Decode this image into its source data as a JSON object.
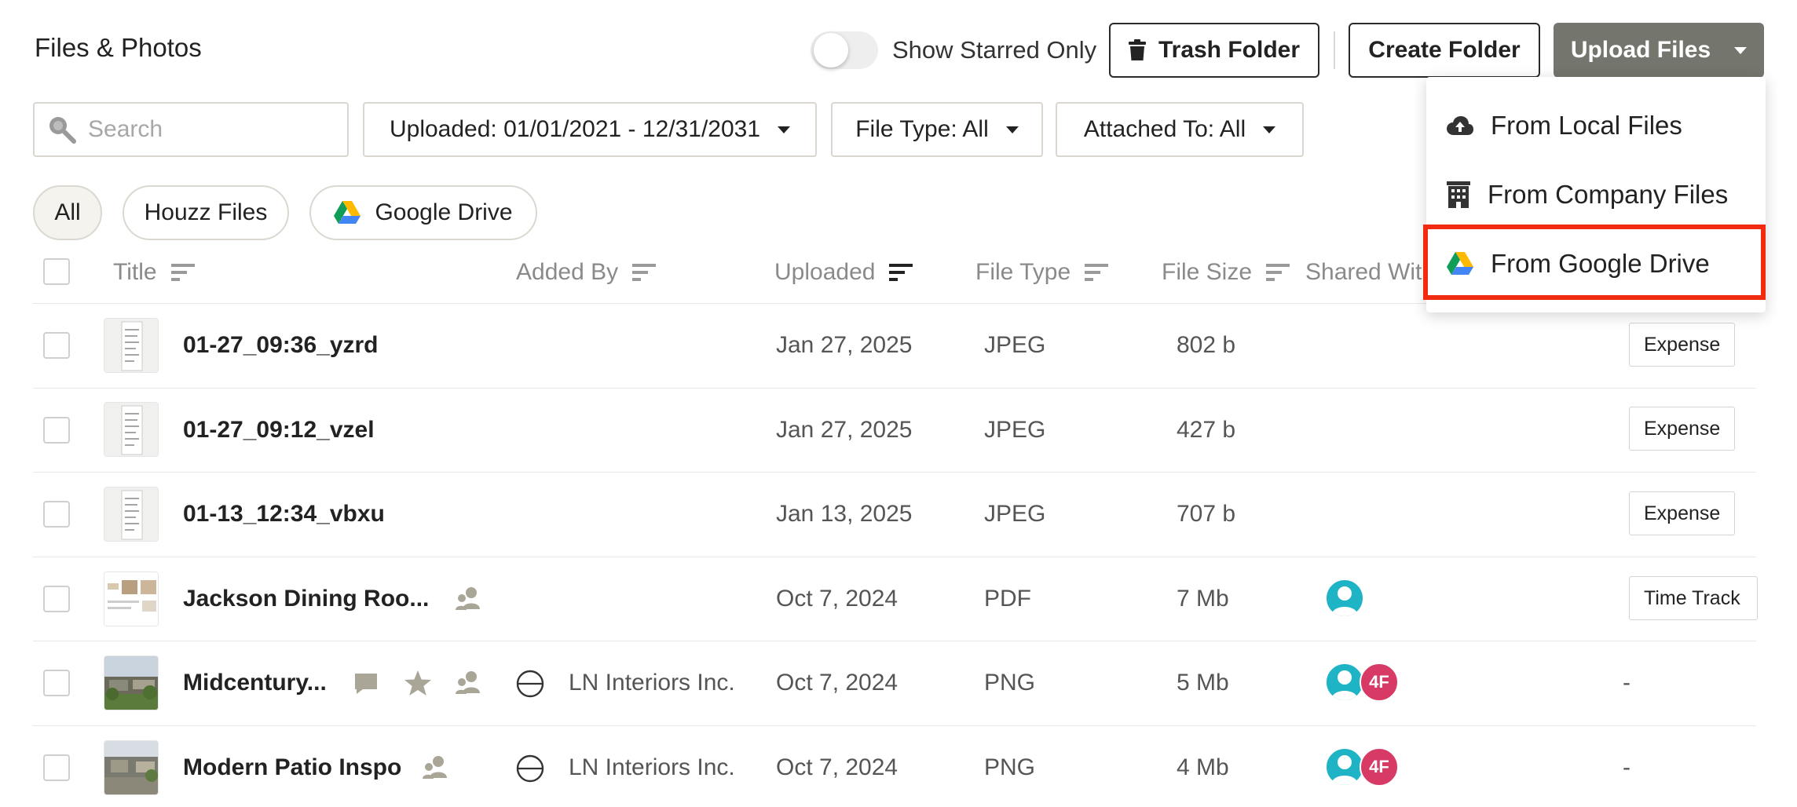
{
  "header": {
    "title": "Files & Photos",
    "toggle_label": "Show Starred Only",
    "trash_label": "Trash Folder",
    "create_label": "Create Folder",
    "upload_label": "Upload Files"
  },
  "filters": {
    "search_placeholder": "Search",
    "uploaded": "Uploaded: 01/01/2021 - 12/31/2031",
    "file_type": "File Type: All",
    "attached_to": "Attached To: All"
  },
  "chips": {
    "all": "All",
    "houzz": "Houzz Files",
    "gdrive": "Google Drive"
  },
  "columns": {
    "title": "Title",
    "added_by": "Added By",
    "uploaded": "Uploaded",
    "file_type": "File Type",
    "file_size": "File Size",
    "shared_with": "Shared With"
  },
  "rows": [
    {
      "title": "01-27_09:36_yzrd",
      "added_by": "",
      "uploaded": "Jan 27, 2025",
      "type": "JPEG",
      "size": "802 b",
      "attached": "Expense"
    },
    {
      "title": "01-27_09:12_vzel",
      "added_by": "",
      "uploaded": "Jan 27, 2025",
      "type": "JPEG",
      "size": "427 b",
      "attached": "Expense"
    },
    {
      "title": "01-13_12:34_vbxu",
      "added_by": "",
      "uploaded": "Jan 13, 2025",
      "type": "JPEG",
      "size": "707 b",
      "attached": "Expense"
    },
    {
      "title": "Jackson Dining Roo...",
      "added_by": "",
      "uploaded": "Oct 7, 2024",
      "type": "PDF",
      "size": "7 Mb",
      "attached": "Time Track"
    },
    {
      "title": "Midcentury...",
      "added_by": "LN Interiors Inc.",
      "uploaded": "Oct 7, 2024",
      "type": "PNG",
      "size": "5 Mb",
      "attached": "-",
      "avatar2": "4F"
    },
    {
      "title": "Modern Patio Inspo",
      "added_by": "LN Interiors Inc.",
      "uploaded": "Oct 7, 2024",
      "type": "PNG",
      "size": "4 Mb",
      "attached": "-",
      "avatar2": "4F"
    }
  ],
  "dropdown": {
    "local": "From Local Files",
    "company": "From Company Files",
    "gdrive": "From Google Drive"
  },
  "colors": {
    "upload_button": "#74766d",
    "highlight": "#f02b10",
    "avatar_teal": "#1fb3c6",
    "avatar_pink": "#d83a66"
  }
}
